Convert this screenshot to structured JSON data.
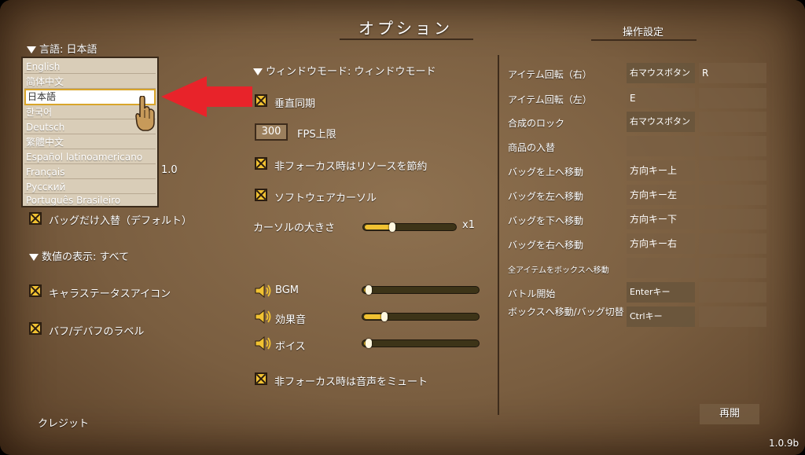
{
  "title": "オプション",
  "controls_title": "操作設定",
  "language": {
    "label": "言語: 日本語",
    "options": [
      "English",
      "简体中文",
      "日本語",
      "한국어",
      "Deutsch",
      "繁體中文",
      "Español latinoamericano",
      "Français",
      "Русский",
      "Português Brasileiro"
    ],
    "selected": "日本語"
  },
  "left": {
    "partial_value": "1.0",
    "bag_swap": "バッグだけ入替（デフォルト）",
    "number_display": "数値の表示: すべて",
    "char_status_icon": "キャラステータスアイコン",
    "buff_label": "バフ/デバフのラベル",
    "credits": "クレジット"
  },
  "middle": {
    "window_mode": "ウィンドウモード: ウィンドウモード",
    "vsync": "垂直同期",
    "fps_value": "300",
    "fps_label": "FPS上限",
    "save_resources": "非フォーカス時はリソースを節約",
    "software_cursor": "ソフトウェアカーソル",
    "cursor_size_label": "カーソルの大きさ",
    "cursor_size_value": "x1",
    "cursor_size_level": 0.3,
    "bgm_label": "BGM",
    "bgm_level": 0.04,
    "sfx_label": "効果音",
    "sfx_level": 0.18,
    "voice_label": "ボイス",
    "voice_level": 0.04,
    "mute_unfocused": "非フォーカス時は音声をミュート"
  },
  "controls": [
    {
      "label": "アイテム回転（右）",
      "key1": "右マウスボタン",
      "key2": "R"
    },
    {
      "label": "アイテム回転（左）",
      "key1": "E",
      "key2": ""
    },
    {
      "label": "合成のロック",
      "key1": "右マウスボタン",
      "key2": ""
    },
    {
      "label": "商品の入替",
      "key1": "",
      "key2": ""
    },
    {
      "label": "バッグを上へ移動",
      "key1": "方向キー上",
      "key2": ""
    },
    {
      "label": "バッグを左へ移動",
      "key1": "方向キー左",
      "key2": ""
    },
    {
      "label": "バッグを下へ移動",
      "key1": "方向キー下",
      "key2": ""
    },
    {
      "label": "バッグを右へ移動",
      "key1": "方向キー右",
      "key2": ""
    },
    {
      "label": "全アイテムをボックスへ移動",
      "key1": "",
      "key2": ""
    },
    {
      "label": "バトル開始",
      "key1": "Enterキー",
      "key2": ""
    },
    {
      "label": "ボックスへ移動/バッグ切替",
      "key1": "Ctrlキー",
      "key2": ""
    }
  ],
  "resume": "再開",
  "version": "1.0.9b",
  "colors": {
    "accent": "#f1c232",
    "arrow": "#e8232a",
    "panel": "#7a5e40"
  }
}
